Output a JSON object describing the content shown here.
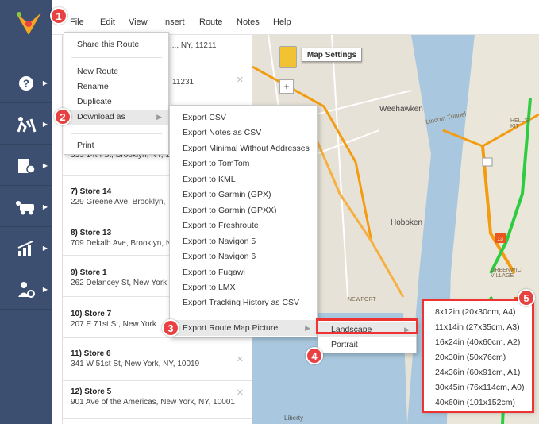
{
  "menu": [
    "File",
    "Edit",
    "View",
    "Insert",
    "Route",
    "Notes",
    "Help"
  ],
  "sidebar_icons": [
    "help-icon",
    "route-icon",
    "stops-icon",
    "team-icon",
    "analytics-icon",
    "user-settings-icon"
  ],
  "route_list": {
    "partial_top": "..., NY, 11211",
    "partial_mid": "11231",
    "stops": [
      {
        "name": "",
        "addr": "333 14th St, Brooklyn, NY, 1"
      },
      {
        "name": "7) Store 14",
        "addr": "229 Greene Ave, Brooklyn,"
      },
      {
        "name": "8) Store 13",
        "addr": "709 Dekalb Ave, Brooklyn, N"
      },
      {
        "name": "9) Store 1",
        "addr": "262 Delancey St, New York"
      },
      {
        "name": "10) Store 7",
        "addr": "207 E 71st St, New York"
      },
      {
        "name": "11) Store 6",
        "addr": "341 W 51st St, New York, NY, 10019"
      },
      {
        "name": "12) Store 5",
        "addr": "901 Ave of the Americas, New York, NY, 10001"
      }
    ]
  },
  "map": {
    "settings_label": "Map Settings",
    "labels": [
      "Weehawken",
      "Hoboken",
      "Lincoln Tunnel",
      "HELL'S KIT",
      "GREENWIC VILLAGE",
      "NEWPORT",
      "Liberty"
    ]
  },
  "file_menu": {
    "items": [
      "Share this Route",
      "New Route",
      "Rename",
      "Duplicate",
      "Download as",
      "Print"
    ]
  },
  "download_menu": {
    "items": [
      "Export CSV",
      "Export Notes as CSV",
      "Export Minimal Without Addresses",
      "Export to TomTom",
      "Export to KML",
      "Export to Garmin (GPX)",
      "Export to Garmin (GPXX)",
      "Export to Freshroute",
      "Export to Navigon 5",
      "Export to Navigon 6",
      "Export to Fugawi",
      "Export to LMX",
      "Export Tracking History as CSV",
      "Export Route Map Picture"
    ]
  },
  "orientation_menu": {
    "items": [
      "Landscape",
      "Portrait"
    ]
  },
  "size_menu": {
    "items": [
      "8x12in (20x30cm, A4)",
      "11x14in (27x35cm, A3)",
      "16x24in (40x60cm, A2)",
      "20x30in (50x76cm)",
      "24x36in (60x91cm, A1)",
      "30x45in (76x114cm, A0)",
      "40x60in (101x152cm)"
    ]
  },
  "callouts": [
    "1",
    "2",
    "3",
    "4",
    "5"
  ],
  "colors": {
    "sidebar": "#3d4f70",
    "callout": "#e84141",
    "route_orange": "#f39c12",
    "route_green": "#2ecc40"
  }
}
